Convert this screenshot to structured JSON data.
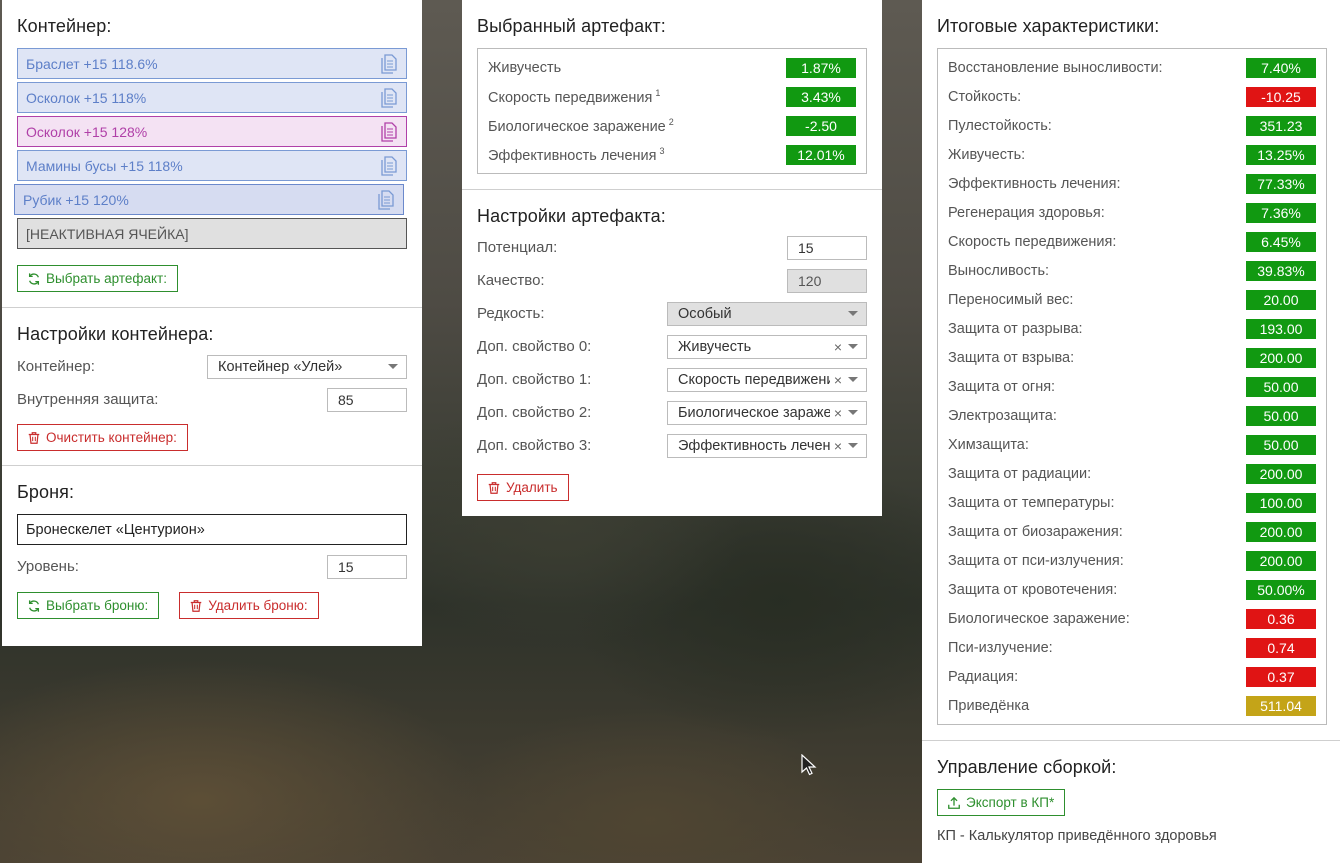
{
  "container": {
    "title": "Контейнер:",
    "slots": [
      {
        "label": "Браслет +15 118.6%"
      },
      {
        "label": "Осколок +15 118%"
      },
      {
        "label": "Осколок +15 128%"
      },
      {
        "label": "Мамины бусы +15 118%"
      },
      {
        "label": "Рубик +15 120%"
      },
      {
        "label": "[НЕАКТИВНАЯ ЯЧЕЙКА]"
      }
    ],
    "select_artifact_label": "Выбрать артефакт:"
  },
  "container_settings": {
    "title": "Настройки контейнера:",
    "container_label": "Контейнер:",
    "container_value": "Контейнер «Улей»",
    "inner_protection_label": "Внутренняя защита:",
    "inner_protection_value": "85",
    "clear_label": "Очистить контейнер:"
  },
  "armor": {
    "title": "Броня:",
    "name": "Бронескелет «Центурион»",
    "level_label": "Уровень:",
    "level_value": "15",
    "select_label": "Выбрать броню:",
    "delete_label": "Удалить броню:"
  },
  "selected_artifact": {
    "title": "Выбранный артефакт:",
    "stats": [
      {
        "label": "Живучесть",
        "sup": "",
        "value": "1.87%",
        "color": "#119911"
      },
      {
        "label": "Скорость передвижения",
        "sup": "1",
        "value": "3.43%",
        "color": "#119911"
      },
      {
        "label": "Биологическое заражение",
        "sup": "2",
        "value": "-2.50",
        "color": "#119911"
      },
      {
        "label": "Эффективность лечения",
        "sup": "3",
        "value": "12.01%",
        "color": "#119911"
      }
    ]
  },
  "artifact_settings": {
    "title": "Настройки артефакта:",
    "potential_label": "Потенциал:",
    "potential_value": "15",
    "quality_label": "Качество:",
    "quality_value": "120",
    "rarity_label": "Редкость:",
    "rarity_value": "Особый",
    "extra": [
      {
        "label": "Доп. свойство 0:",
        "value": "Живучесть"
      },
      {
        "label": "Доп. свойство 1:",
        "value": "Скорость передвижения"
      },
      {
        "label": "Доп. свойство 2:",
        "value": "Биологическое заражение"
      },
      {
        "label": "Доп. свойство 3:",
        "value": "Эффективность лечения"
      }
    ],
    "delete_label": "Удалить"
  },
  "totals": {
    "title": "Итоговые характеристики:",
    "stats": [
      {
        "label": "Восстановление выносливости:",
        "value": "7.40%",
        "color": "green"
      },
      {
        "label": "Стойкость:",
        "value": "-10.25",
        "color": "red"
      },
      {
        "label": "Пулестойкость:",
        "value": "351.23",
        "color": "green"
      },
      {
        "label": "Живучесть:",
        "value": "13.25%",
        "color": "green"
      },
      {
        "label": "Эффективность лечения:",
        "value": "77.33%",
        "color": "green"
      },
      {
        "label": "Регенерация здоровья:",
        "value": "7.36%",
        "color": "green"
      },
      {
        "label": "Скорость передвижения:",
        "value": "6.45%",
        "color": "green"
      },
      {
        "label": "Выносливость:",
        "value": "39.83%",
        "color": "green"
      },
      {
        "label": "Переносимый вес:",
        "value": "20.00",
        "color": "green"
      },
      {
        "label": "Защита от разрыва:",
        "value": "193.00",
        "color": "green"
      },
      {
        "label": "Защита от взрыва:",
        "value": "200.00",
        "color": "green"
      },
      {
        "label": "Защита от огня:",
        "value": "50.00",
        "color": "green"
      },
      {
        "label": "Электрозащита:",
        "value": "50.00",
        "color": "green"
      },
      {
        "label": "Химзащита:",
        "value": "50.00",
        "color": "green"
      },
      {
        "label": "Защита от радиации:",
        "value": "200.00",
        "color": "green"
      },
      {
        "label": "Защита от температуры:",
        "value": "100.00",
        "color": "green"
      },
      {
        "label": "Защита от биозаражения:",
        "value": "200.00",
        "color": "green"
      },
      {
        "label": "Защита от пси-излучения:",
        "value": "200.00",
        "color": "green"
      },
      {
        "label": "Защита от кровотечения:",
        "value": "50.00%",
        "color": "green"
      },
      {
        "label": "Биологическое заражение:",
        "value": "0.36",
        "color": "red"
      },
      {
        "label": "Пси-излучение:",
        "value": "0.74",
        "color": "red"
      },
      {
        "label": "Радиация:",
        "value": "0.37",
        "color": "red"
      },
      {
        "label": "Приведёнка",
        "value": "511.04",
        "color": "gold"
      }
    ]
  },
  "build": {
    "title": "Управление сборкой:",
    "export_label": "Экспорт в КП*",
    "footnote": "КП - Калькулятор приведённого здоровья"
  },
  "colors": {
    "green": "#119911",
    "red": "#e01414",
    "gold": "#c4a418",
    "slot_blue": "#5d7fc8",
    "slot_pink": "#b040a8"
  }
}
